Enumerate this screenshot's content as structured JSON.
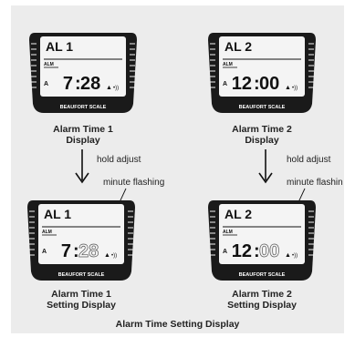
{
  "devices": [
    {
      "id": "d1",
      "header": "AL 1",
      "alm": "ALM",
      "a": "A",
      "hour": "7",
      "minute": "28",
      "minute_style": "solid",
      "brand": "BEAUFORT SCALE",
      "caption": [
        "Alarm Time 1",
        "Display"
      ]
    },
    {
      "id": "d2",
      "header": "AL 2",
      "alm": "ALM",
      "a": "A",
      "hour": "12",
      "minute": "00",
      "minute_style": "solid",
      "brand": "BEAUFORT SCALE",
      "caption": [
        "Alarm Time 2",
        "Display"
      ]
    },
    {
      "id": "d3",
      "header": "AL 1",
      "alm": "ALM",
      "a": "A",
      "hour": "7",
      "minute": "28",
      "minute_style": "outline",
      "brand": "BEAUFORT SCALE",
      "caption": [
        "Alarm Time 1",
        "Setting Display"
      ]
    },
    {
      "id": "d4",
      "header": "AL 2",
      "alm": "ALM",
      "a": "A",
      "hour": "12",
      "minute": "00",
      "minute_style": "outline",
      "brand": "BEAUFORT SCALE",
      "caption": [
        "Alarm Time 2",
        "Setting Display"
      ]
    }
  ],
  "transitions": [
    {
      "action": "hold adjust",
      "annotation": "minute flashing"
    },
    {
      "action": "hold adjust",
      "annotation": "minute flashin"
    }
  ],
  "title": "Alarm Time Setting Display",
  "colors": {
    "panel": "#ececec",
    "bezel": "#1a1a1a",
    "screen": "#f4f4f4",
    "ink": "#111111"
  }
}
